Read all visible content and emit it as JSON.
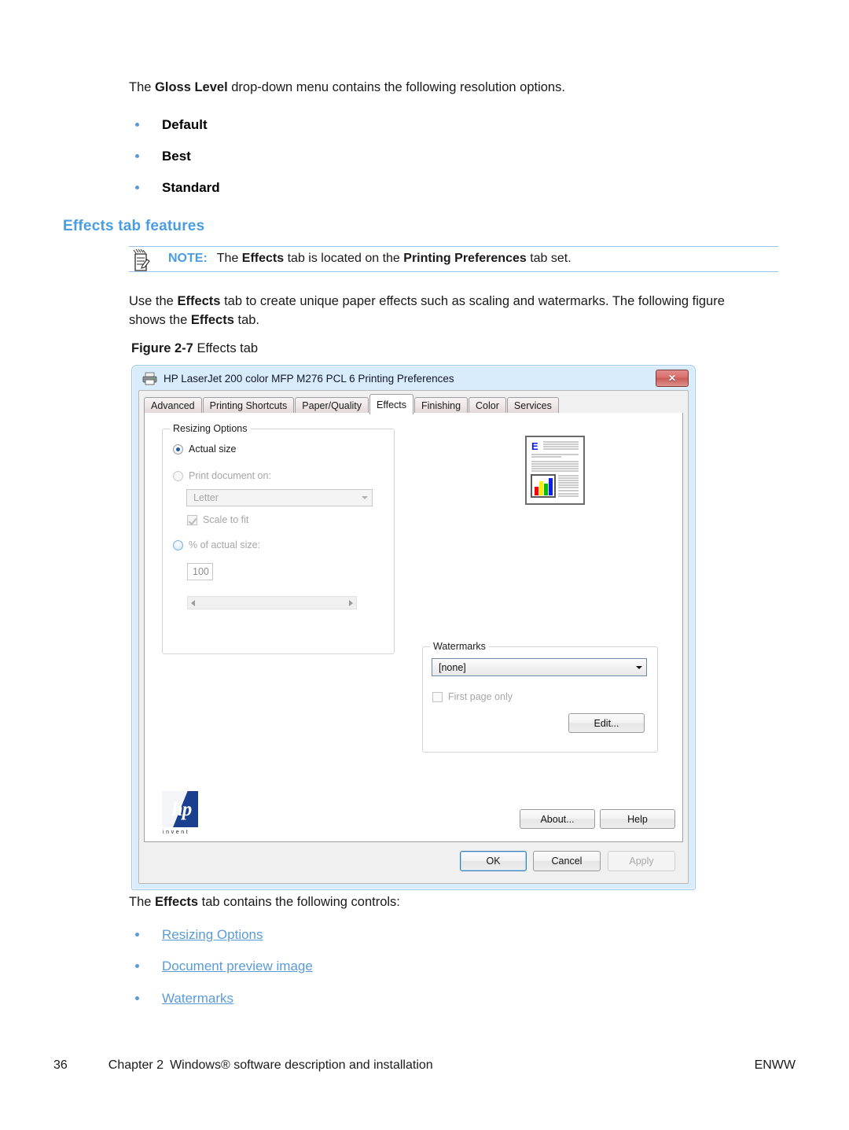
{
  "document": {
    "intro_paragraph": {
      "prefix": "The ",
      "bold": "Gloss Level",
      "suffix": " drop-down menu contains the following resolution options."
    },
    "gloss_options": [
      "Default",
      "Best",
      "Standard"
    ],
    "section_heading": "Effects tab features",
    "note": {
      "label": "NOTE:",
      "icon": "note-pad-icon",
      "prefix": "The ",
      "bold1": "Effects",
      "middle": " tab is located on the ",
      "bold2": "Printing Preferences",
      "suffix": " tab set."
    },
    "use_paragraph": {
      "prefix": "Use the ",
      "bold1": "Effects",
      "middle": " tab to create unique paper effects such as scaling and watermarks. The following figure shows the ",
      "bold2": "Effects",
      "suffix": " tab."
    },
    "figure_caption": {
      "number": "Figure 2-7",
      "title": "Effects tab"
    },
    "controls_paragraph": {
      "prefix": "The ",
      "bold": "Effects",
      "suffix": " tab contains the following controls:"
    },
    "control_links": [
      "Resizing Options",
      "Document preview image",
      "Watermarks"
    ]
  },
  "dialog": {
    "title": "HP LaserJet 200 color MFP M276 PCL 6 Printing Preferences",
    "titlebar_icon": "printer-icon",
    "close_label": "✕",
    "tabs": [
      {
        "label": "Advanced",
        "active": false
      },
      {
        "label": "Printing Shortcuts",
        "active": false
      },
      {
        "label": "Paper/Quality",
        "active": false
      },
      {
        "label": "Effects",
        "active": true
      },
      {
        "label": "Finishing",
        "active": false
      },
      {
        "label": "Color",
        "active": false
      },
      {
        "label": "Services",
        "active": false
      }
    ],
    "resizing": {
      "legend": "Resizing Options",
      "actual_size": "Actual size",
      "print_document_on": "Print document on:",
      "paper_size_value": "Letter",
      "scale_to_fit": "Scale to fit",
      "percent_of_actual_size": "% of actual size:",
      "percent_value": "100"
    },
    "watermarks": {
      "legend": "Watermarks",
      "selected": "[none]",
      "first_page_only": "First page only",
      "edit_label": "Edit..."
    },
    "buttons": {
      "about": "About...",
      "help": "Help",
      "ok": "OK",
      "cancel": "Cancel",
      "apply": "Apply"
    },
    "brand": {
      "logo_text": "hp",
      "tagline": "invent"
    }
  },
  "footer": {
    "page_number": "36",
    "chapter": "Chapter 2",
    "chapter_title": "Windows® software description and installation",
    "right": "ENWW"
  },
  "colors": {
    "accent_blue": "#4a9de0",
    "link_blue": "#5b9bd5",
    "bullet_blue": "#5b9bd5",
    "note_rule": "#9dc3e6",
    "window_frame": "#d9ecfb",
    "hp_navy": "#1b3f8f"
  }
}
